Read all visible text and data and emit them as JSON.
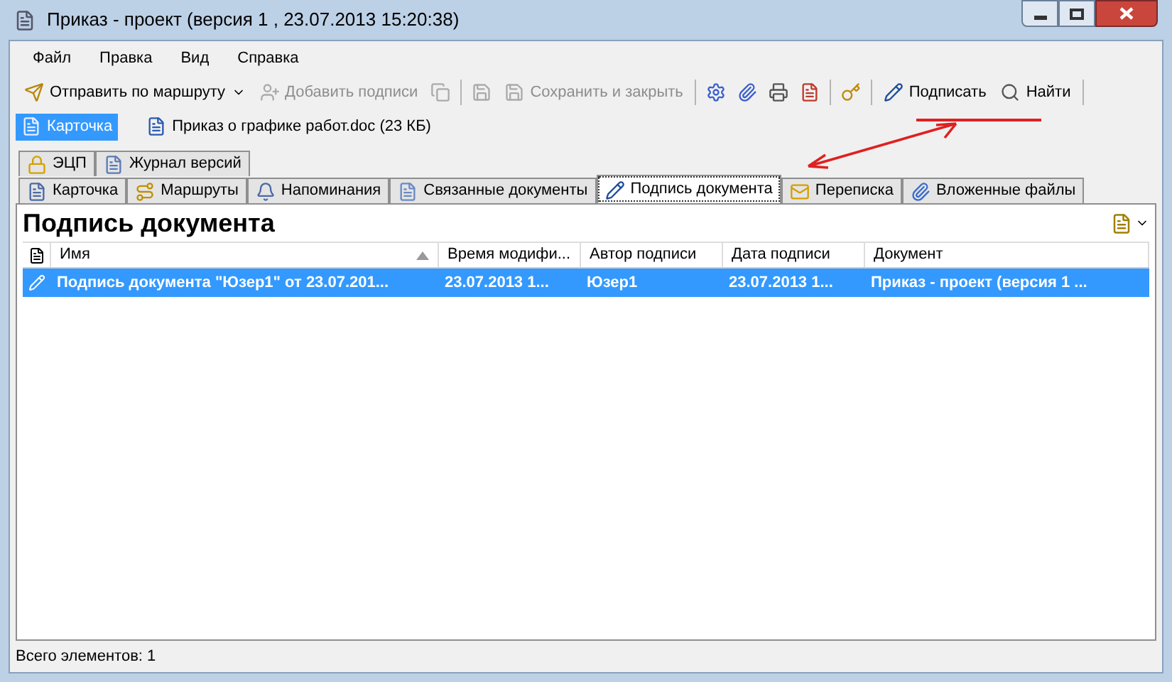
{
  "window": {
    "title": "Приказ - проект (версия 1 , 23.07.2013 15:20:38)"
  },
  "menu": [
    "Файл",
    "Правка",
    "Вид",
    "Справка"
  ],
  "toolbar": [
    {
      "kind": "button",
      "label": "Отправить по маршруту",
      "dropdown": true,
      "disabled": false
    },
    {
      "kind": "button",
      "label": "Добавить подписи",
      "dropdown": false,
      "disabled": true
    },
    {
      "kind": "icon",
      "disabled": true
    },
    {
      "kind": "separator"
    },
    {
      "kind": "icon",
      "disabled": true
    },
    {
      "kind": "button",
      "label": "Сохранить и закрыть",
      "dropdown": false,
      "disabled": true
    },
    {
      "kind": "separator"
    },
    {
      "kind": "icon",
      "disabled": false
    },
    {
      "kind": "icon",
      "disabled": false
    },
    {
      "kind": "icon",
      "disabled": false
    },
    {
      "kind": "icon",
      "disabled": false
    },
    {
      "kind": "separator"
    },
    {
      "kind": "icon",
      "disabled": false
    },
    {
      "kind": "separator"
    },
    {
      "kind": "button",
      "label": "Подписать",
      "dropdown": false,
      "disabled": false
    },
    {
      "kind": "button",
      "label": "Найти",
      "dropdown": false,
      "disabled": false
    },
    {
      "kind": "separator"
    }
  ],
  "doc_tabs": [
    {
      "label": "Карточка",
      "selected": true
    },
    {
      "label": "Приказ о графике работ.doc (23 КБ)",
      "selected": false
    }
  ],
  "tab_rows": [
    [
      {
        "label": "ЭЦП",
        "selected": false
      },
      {
        "label": "Журнал версий",
        "selected": false
      }
    ],
    [
      {
        "label": "Карточка",
        "selected": false
      },
      {
        "label": "Маршруты",
        "selected": false
      },
      {
        "label": "Напоминания",
        "selected": false
      },
      {
        "label": "Связанные документы",
        "selected": false
      },
      {
        "label": "Подпись документа",
        "selected": true
      },
      {
        "label": "Переписка",
        "selected": false
      },
      {
        "label": "Вложенные файлы",
        "selected": false
      }
    ]
  ],
  "panel": {
    "title": "Подпись документа",
    "columns": [
      {
        "label": "Имя",
        "sorted": true
      },
      {
        "label": "Время модифи...",
        "sorted": false
      },
      {
        "label": "Автор подписи",
        "sorted": false
      },
      {
        "label": "Дата подписи",
        "sorted": false
      },
      {
        "label": "Документ",
        "sorted": false
      }
    ],
    "rows": [
      {
        "selected": true,
        "cells": [
          "Подпись документа \"Юзер1\" от 23.07.201...",
          "23.07.2013 1...",
          "Юзер1",
          "23.07.2013 1...",
          "Приказ - проект (версия 1 ..."
        ]
      }
    ]
  },
  "status_bar": "Всего элементов: 1"
}
